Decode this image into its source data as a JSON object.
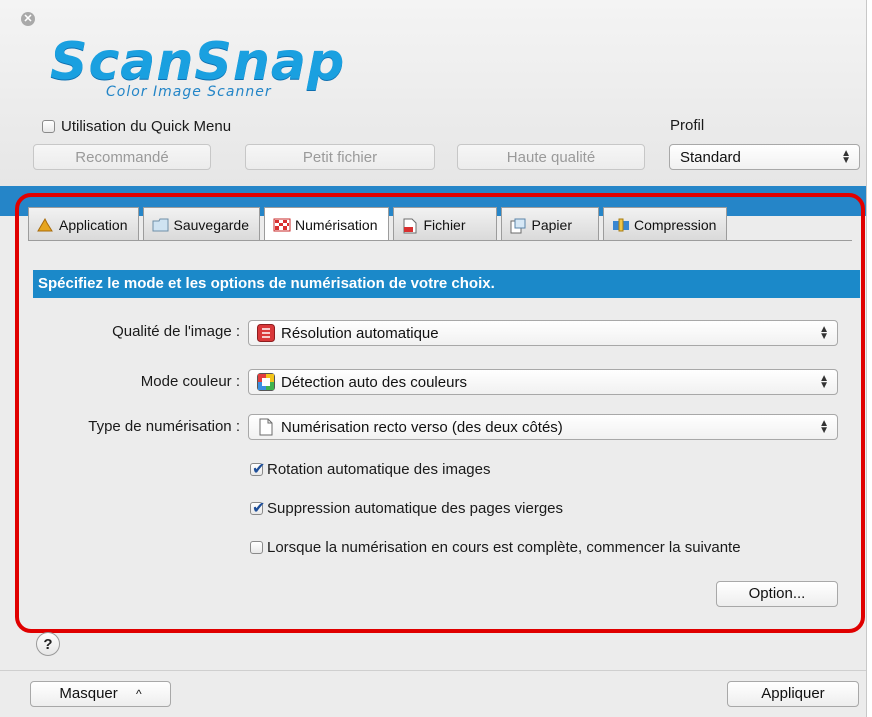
{
  "logo": {
    "main": "ScanSnap",
    "sub": "Color Image Scanner"
  },
  "quick_menu": {
    "label": "Utilisation du Quick Menu",
    "checked": false
  },
  "profile": {
    "label": "Profil",
    "value": "Standard"
  },
  "quick_buttons": [
    "Recommandé",
    "Petit fichier",
    "Haute qualité"
  ],
  "tabs": [
    {
      "label": "Application",
      "icon": "application-icon"
    },
    {
      "label": "Sauvegarde",
      "icon": "folder-icon"
    },
    {
      "label": "Numérisation",
      "icon": "scanning-icon",
      "active": true
    },
    {
      "label": "Fichier",
      "icon": "file-icon"
    },
    {
      "label": "Papier",
      "icon": "paper-icon"
    },
    {
      "label": "Compression",
      "icon": "compression-icon"
    }
  ],
  "instruction": "Spécifiez le mode et les options de numérisation de votre choix.",
  "settings": {
    "quality": {
      "label": "Qualité de l'image :",
      "value": "Résolution automatique"
    },
    "color": {
      "label": "Mode couleur :",
      "value": "Détection auto des couleurs"
    },
    "scan_type": {
      "label": "Type de numérisation :",
      "value": "Numérisation recto verso (des deux côtés)"
    }
  },
  "options": [
    {
      "label": "Rotation automatique des images",
      "checked": true
    },
    {
      "label": "Suppression automatique des pages vierges",
      "checked": true
    },
    {
      "label": "Lorsque la numérisation en cours est complète, commencer la suivante",
      "checked": false
    }
  ],
  "option_button": "Option...",
  "help": "?",
  "footer": {
    "hide": "Masquer",
    "hide_chevron": "^",
    "apply": "Appliquer"
  },
  "colors": {
    "accent_blue": "#1b89c9",
    "highlight_frame": "#e00000"
  }
}
